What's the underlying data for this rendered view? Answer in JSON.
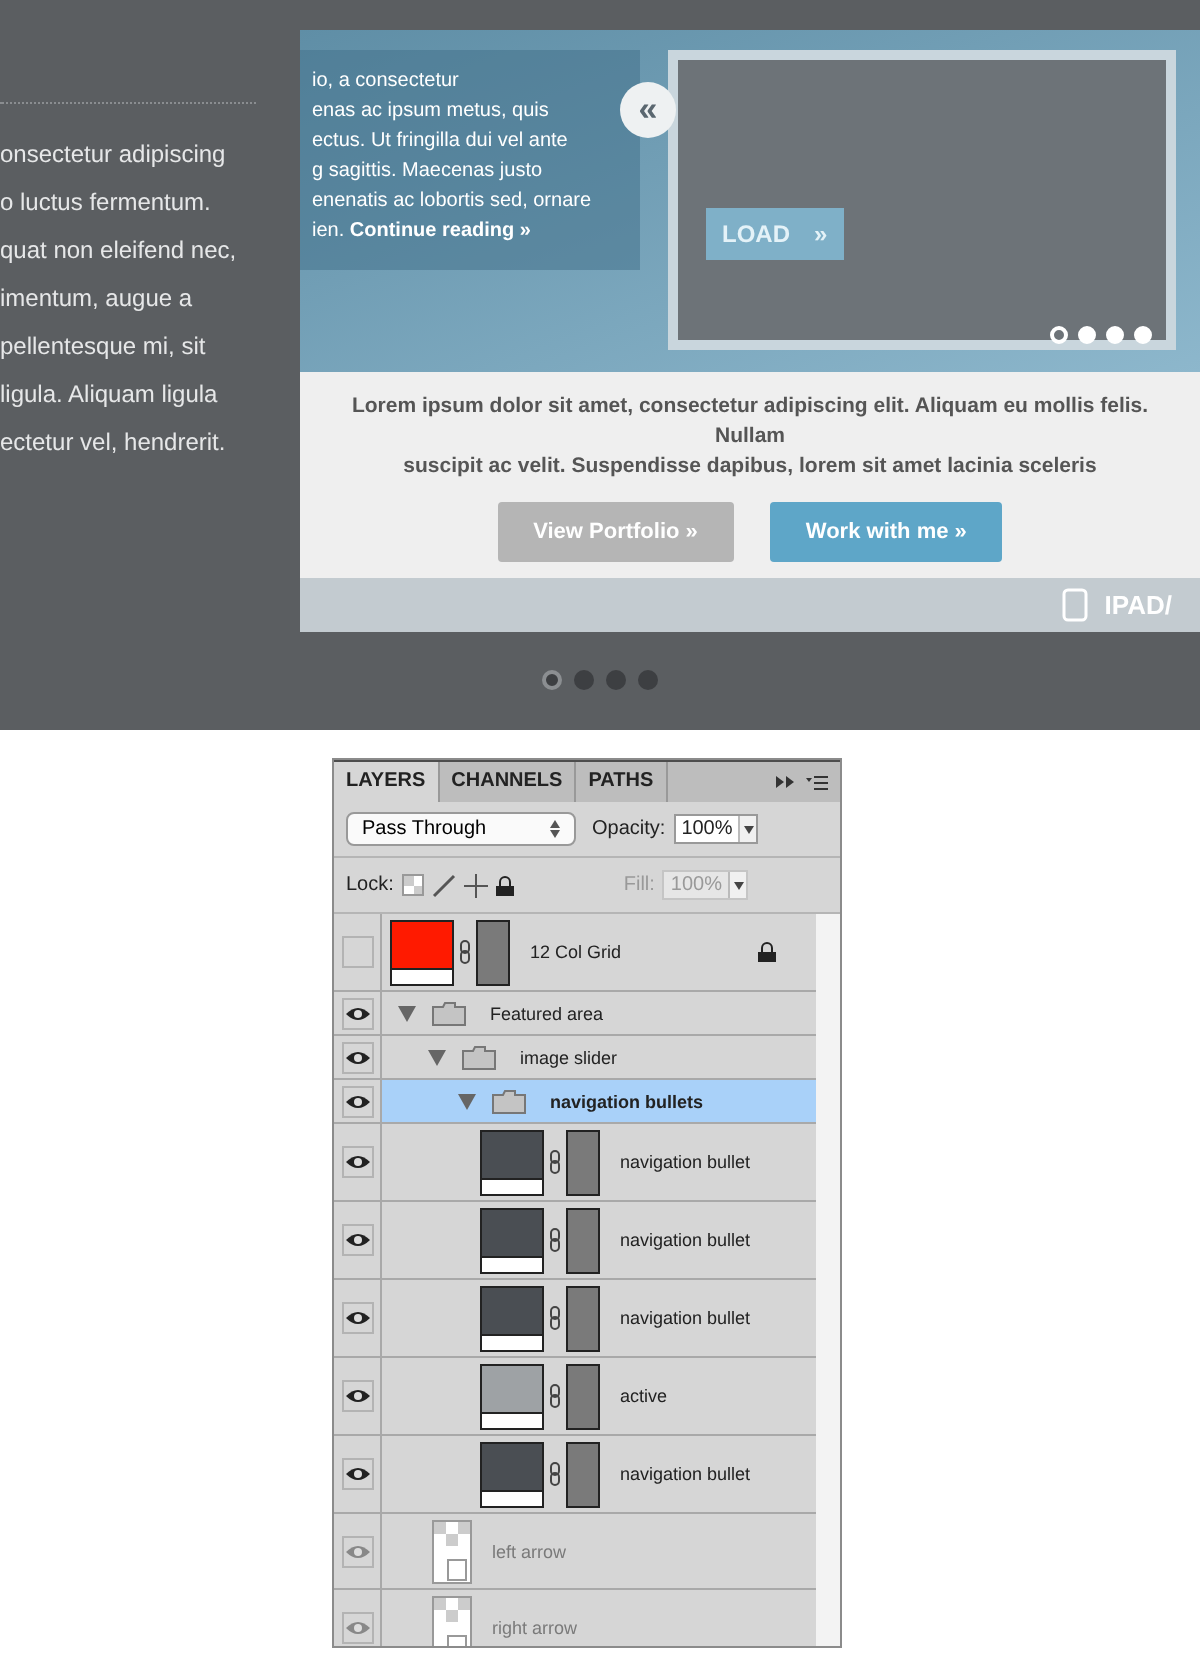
{
  "hero": {
    "intro_lines": [
      "onsectetur adipiscing",
      "o luctus fermentum.",
      "quat non eleifend nec,",
      "imentum, augue a",
      "pellentesque mi, sit",
      "ligula. Aliquam ligula",
      "ectetur vel, hendrerit."
    ],
    "mockup": {
      "blurb_lines": [
        "io, a consectetur",
        "enas ac ipsum metus, quis",
        "ectus. Ut fringilla dui vel ante",
        "g sagittis. Maecenas justo",
        "enenatis ac lobortis sed, ornare",
        "ien. **Continue reading »**"
      ],
      "load_button": "LOAD",
      "load_arrow": "»",
      "prev_arrow": "«",
      "inner_dots": [
        {
          "selected": true
        },
        {
          "selected": false
        },
        {
          "selected": false
        },
        {
          "selected": false
        }
      ],
      "tagline_lines": [
        "Lorem ipsum dolor sit amet, consectetur adipiscing elit. Aliquam eu mollis felis. Nullam",
        "suscipit ac velit. Suspendisse dapibus, lorem sit amet lacinia sceleris"
      ],
      "buttons": [
        {
          "label": "View Portfolio »",
          "kind": "secondary"
        },
        {
          "label": "Work with me »",
          "kind": "primary"
        }
      ],
      "device_label": "IPAD/"
    },
    "slider_dots": [
      {
        "selected": true
      },
      {
        "selected": false
      },
      {
        "selected": false
      },
      {
        "selected": false
      }
    ]
  },
  "layers_panel": {
    "tabs": [
      {
        "label": "LAYERS",
        "selected": true
      },
      {
        "label": "CHANNELS",
        "selected": false
      },
      {
        "label": "PATHS",
        "selected": false
      }
    ],
    "blend_mode": "Pass Through",
    "opacity_label": "Opacity:",
    "opacity": "100%",
    "lock_label": "Lock:",
    "fill_label": "Fill:",
    "fill": "100%",
    "fill_disabled": true,
    "layers": [
      {
        "name": "12 Col Grid",
        "kind": "layer",
        "color": "#ff1a00",
        "visible": false,
        "locked": true,
        "selected": false
      },
      {
        "name": "Featured area",
        "kind": "group",
        "visible": true,
        "expanded": true,
        "selected": false,
        "children": [
          {
            "name": "image slider",
            "kind": "group",
            "visible": true,
            "expanded": true,
            "selected": false,
            "children": [
              {
                "name": "navigation bullets",
                "kind": "group",
                "visible": true,
                "expanded": true,
                "selected": true,
                "children": [
                  {
                    "name": "navigation bullet",
                    "kind": "layer",
                    "color": "#4a4e53",
                    "visible": true,
                    "selected": false
                  },
                  {
                    "name": "navigation bullet",
                    "kind": "layer",
                    "color": "#4a4e53",
                    "visible": true,
                    "selected": false
                  },
                  {
                    "name": "navigation bullet",
                    "kind": "layer",
                    "color": "#4a4e53",
                    "visible": true,
                    "selected": false
                  },
                  {
                    "name": "active",
                    "kind": "layer",
                    "color": "#9ea2a5",
                    "visible": true,
                    "selected": false
                  },
                  {
                    "name": "navigation bullet",
                    "kind": "layer",
                    "color": "#4a4e53",
                    "visible": true,
                    "selected": false
                  }
                ]
              }
            ]
          },
          {
            "name": "left arrow",
            "kind": "smart",
            "visible": true,
            "selected": false,
            "faded": true
          },
          {
            "name": "right arrow",
            "kind": "smart",
            "visible": true,
            "selected": false,
            "faded": true
          }
        ]
      }
    ]
  }
}
